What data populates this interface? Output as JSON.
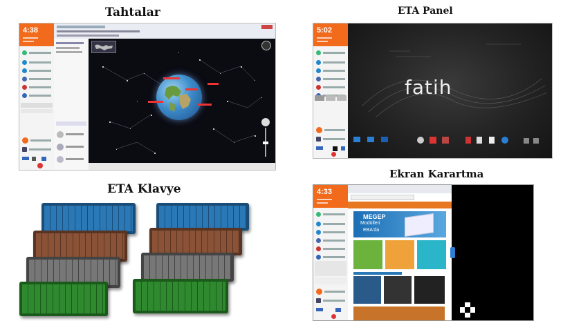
{
  "titles": {
    "tahtalar": "Tahtalar",
    "eta_panel": "ETA Panel",
    "eta_klavye": "ETA Klavye",
    "ekran_karartma": "Ekran Karartma"
  },
  "tahtalar_screen": {
    "clock": "4:38",
    "globe_icon": "globe-icon",
    "compass_icon": "compass-icon"
  },
  "eta_panel_screen": {
    "clock": "5:02",
    "wallpaper_logo": "fatih"
  },
  "ekran_karartma_screen": {
    "clock": "4:33",
    "banner_title": "MEGEP",
    "banner_sub1": "Modülleri",
    "banner_sub2": "EBA'da"
  },
  "keyboards": {
    "colors": [
      "#2a78b5",
      "#8a5236",
      "#777777",
      "#2f8a2f"
    ]
  },
  "colors": {
    "accent_orange": "#f26b1d",
    "space_bg": "#0b0b12"
  }
}
